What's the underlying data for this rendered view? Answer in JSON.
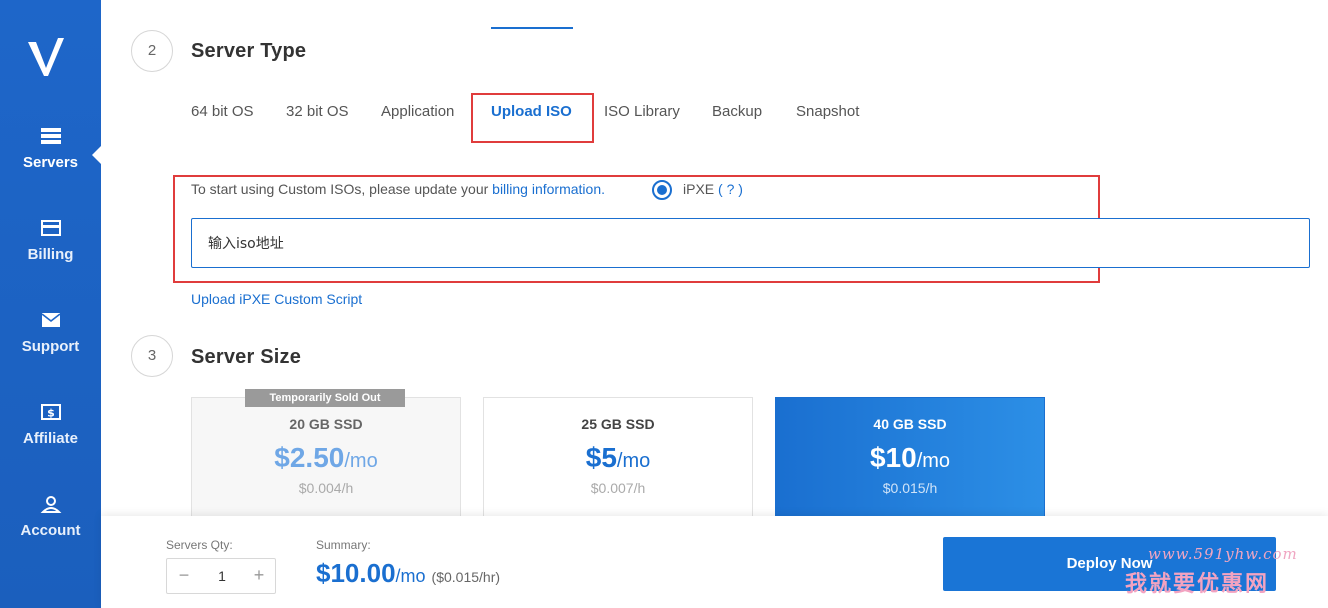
{
  "sidebar": {
    "logo_text": "V",
    "items": [
      {
        "label": "Servers",
        "icon": "servers-icon"
      },
      {
        "label": "Billing",
        "icon": "credit-card-icon"
      },
      {
        "label": "Support",
        "icon": "envelope-icon"
      },
      {
        "label": "Affiliate",
        "icon": "dollar-bill-icon"
      },
      {
        "label": "Account",
        "icon": "user-icon"
      }
    ]
  },
  "step2": {
    "number": "2",
    "title": "Server Type",
    "tabs": [
      "64 bit OS",
      "32 bit OS",
      "Application",
      "Upload ISO",
      "ISO Library",
      "Backup",
      "Snapshot"
    ],
    "active_tab": "Upload ISO",
    "info_text": "To start using Custom ISOs, please update your ",
    "billing_link": "billing information.",
    "ipxe_label": "iPXE",
    "ipxe_paren_open": "(",
    "ipxe_help": "?",
    "ipxe_paren_close": ")",
    "iso_input_value": "输入iso地址",
    "upload_link": "Upload iPXE Custom Script"
  },
  "step3": {
    "number": "3",
    "title": "Server Size",
    "cards": [
      {
        "ssd": "20 GB SSD",
        "price": "$2.50",
        "per": "/mo",
        "hourly": "$0.004/h",
        "badge": "Temporarily Sold Out",
        "state": "disabled"
      },
      {
        "ssd": "25 GB SSD",
        "price": "$5",
        "per": "/mo",
        "hourly": "$0.007/h",
        "state": "normal"
      },
      {
        "ssd": "40 GB SSD",
        "price": "$10",
        "per": "/mo",
        "hourly": "$0.015/h",
        "state": "selected"
      }
    ]
  },
  "footer": {
    "qty_label": "Servers Qty:",
    "qty_minus": "−",
    "qty_value": "1",
    "qty_plus": "+",
    "summary_label": "Summary:",
    "summary_price": "$10.00",
    "summary_per": "/mo",
    "summary_hourly": "($0.015/hr)",
    "deploy_label": "Deploy Now"
  },
  "watermark": {
    "url": "www.591yhw.com",
    "text": "我就要优惠网"
  },
  "colors": {
    "sidebar": "#1e66c9",
    "accent": "#1a6fd0",
    "highlight_box": "#e03c3c",
    "sold_badge": "#9a9a9a"
  }
}
